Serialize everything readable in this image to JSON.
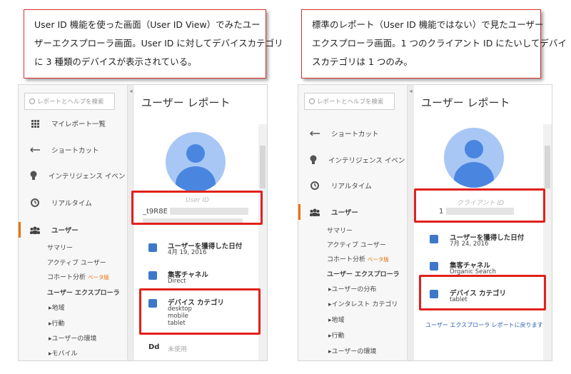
{
  "callouts": {
    "left": {
      "lines": [
        "User ID 機能を使った画面（User ID View）でみたユー",
        "ザーエクスプローラ画面。User ID に対してデバイスカテゴリ",
        "に 3 種類のデバイスが表示されている。"
      ]
    },
    "right": {
      "lines": [
        "標準のレポート（User ID 機能ではない）で見たユーザー",
        "エクスプローラ画面。1 つのクライアント ID にたいしてデバイ",
        "スカテゴリは 1 つのみ。"
      ]
    }
  },
  "left_panel": {
    "search_placeholder": "レポートとヘルプを検索",
    "nav": [
      {
        "label": "マイレポート一覧",
        "icon": "grid-icon"
      },
      {
        "label": "ショートカット",
        "icon": "shortcut-arrow-icon"
      },
      {
        "label": "インテリジェンス イベント",
        "icon": "lightbulb-icon"
      },
      {
        "label": "リアルタイム",
        "icon": "clock-icon"
      },
      {
        "label": "ユーザー",
        "icon": "users-icon"
      }
    ],
    "sub_items": [
      "サマリー",
      "アクティブ ユーザー",
      "コホート分析",
      "ユーザー エクスプローラ",
      "▸地域",
      "▸行動",
      "▸ユーザーの環境",
      "▸モバイル"
    ],
    "beta_label": "ベータ版",
    "page_title": "ユーザー レポート",
    "id_label": "User ID",
    "id_value": "_t9R8E",
    "cards": {
      "acquired": {
        "title": "ユーザーを獲得した日付",
        "value": "4月 19, 2016"
      },
      "channel": {
        "title": "集客チャネル",
        "value": "Direct"
      },
      "device": {
        "title": "デバイス カテゴリ",
        "values": [
          "desktop",
          "mobile",
          "tablet"
        ]
      }
    },
    "dd_label": "Dd",
    "dd_value": "未使用"
  },
  "right_panel": {
    "search_placeholder": "レポートとヘルプを検索",
    "nav": [
      {
        "label": "ショートカット",
        "icon": "shortcut-arrow-icon"
      },
      {
        "label": "インテリジェンス イベント",
        "icon": "lightbulb-icon"
      },
      {
        "label": "リアルタイム",
        "icon": "clock-icon"
      },
      {
        "label": "ユーザー",
        "icon": "users-icon"
      }
    ],
    "sub_items": [
      "サマリー",
      "アクティブ ユーザー",
      "コホート分析",
      "ユーザー エクスプローラ",
      "▸ユーザーの分布",
      "▸インタレスト カテゴリ",
      "▸地域",
      "▸行動",
      "▸ユーザーの環境"
    ],
    "beta_label": "ベータ版",
    "page_title": "ユーザー レポート",
    "id_label": "クライアント ID",
    "id_value": "1",
    "cards": {
      "acquired": {
        "title": "ユーザーを獲得した日付",
        "value": "7月 24, 2016"
      },
      "channel": {
        "title": "集客チャネル",
        "value": "Organic Search"
      },
      "device": {
        "title": "デバイス カテゴリ",
        "values": [
          "tablet"
        ]
      }
    },
    "back_link": "ユーザー エクスプローラ レポートに戻ります"
  },
  "colors": {
    "accent_red": "#e0211b",
    "ga_blue": "#4a86e0",
    "beta_orange": "#e8710a"
  }
}
